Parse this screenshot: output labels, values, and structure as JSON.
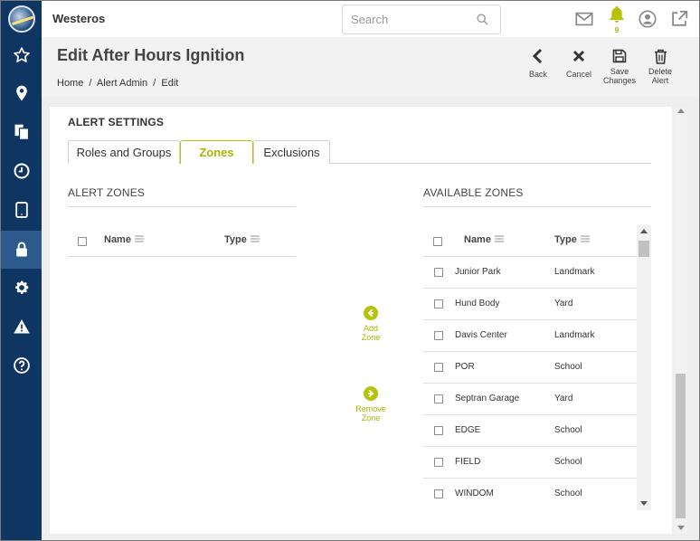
{
  "app": {
    "title": "Westeros"
  },
  "search": {
    "placeholder": "Search",
    "value": ""
  },
  "notifications": {
    "count": "9"
  },
  "colors": {
    "sidebar": "#0f3562",
    "sidebar_active": "#2d5a8c",
    "accent": "#b7c20e",
    "bell": "#b7c20e"
  },
  "sidebar": {
    "items": [
      {
        "icon": "star-icon"
      },
      {
        "icon": "map-pin-icon"
      },
      {
        "icon": "documents-icon"
      },
      {
        "icon": "clock-icon"
      },
      {
        "icon": "tablet-icon"
      },
      {
        "icon": "lock-icon",
        "active": true
      },
      {
        "icon": "gear-icon"
      },
      {
        "icon": "warning-icon"
      },
      {
        "icon": "help-icon"
      }
    ]
  },
  "header": {
    "title": "Edit After Hours Ignition",
    "breadcrumb": [
      "Home",
      "/",
      "Alert Admin",
      "/",
      "Edit"
    ],
    "actions": {
      "back": "Back",
      "cancel": "Cancel",
      "save_line1": "Save",
      "save_line2": "Changes",
      "delete_line1": "Delete",
      "delete_line2": "Alert"
    }
  },
  "alert_settings": {
    "title": "ALERT SETTINGS",
    "tabs": [
      "Roles and Groups",
      "Zones",
      "Exclusions"
    ],
    "active_tab": "Zones"
  },
  "alert_zones": {
    "heading": "ALERT ZONES",
    "columns": {
      "name": "Name",
      "type": "Type"
    },
    "rows": []
  },
  "move": {
    "add_line1": "Add",
    "add_line2": "Zone",
    "remove_line1": "Remove",
    "remove_line2": "Zone"
  },
  "available_zones": {
    "heading": "AVAILABLE ZONES",
    "columns": {
      "name": "Name",
      "type": "Type"
    },
    "rows": [
      {
        "name": "Junior Park",
        "type": "Landmark"
      },
      {
        "name": "Hund Body",
        "type": "Yard"
      },
      {
        "name": "Davis Center",
        "type": "Landmark"
      },
      {
        "name": "POR",
        "type": "School"
      },
      {
        "name": "Septran Garage",
        "type": "Yard"
      },
      {
        "name": "EDGE",
        "type": "School"
      },
      {
        "name": "FIELD",
        "type": "School"
      },
      {
        "name": "WINDOM",
        "type": "School"
      }
    ]
  }
}
